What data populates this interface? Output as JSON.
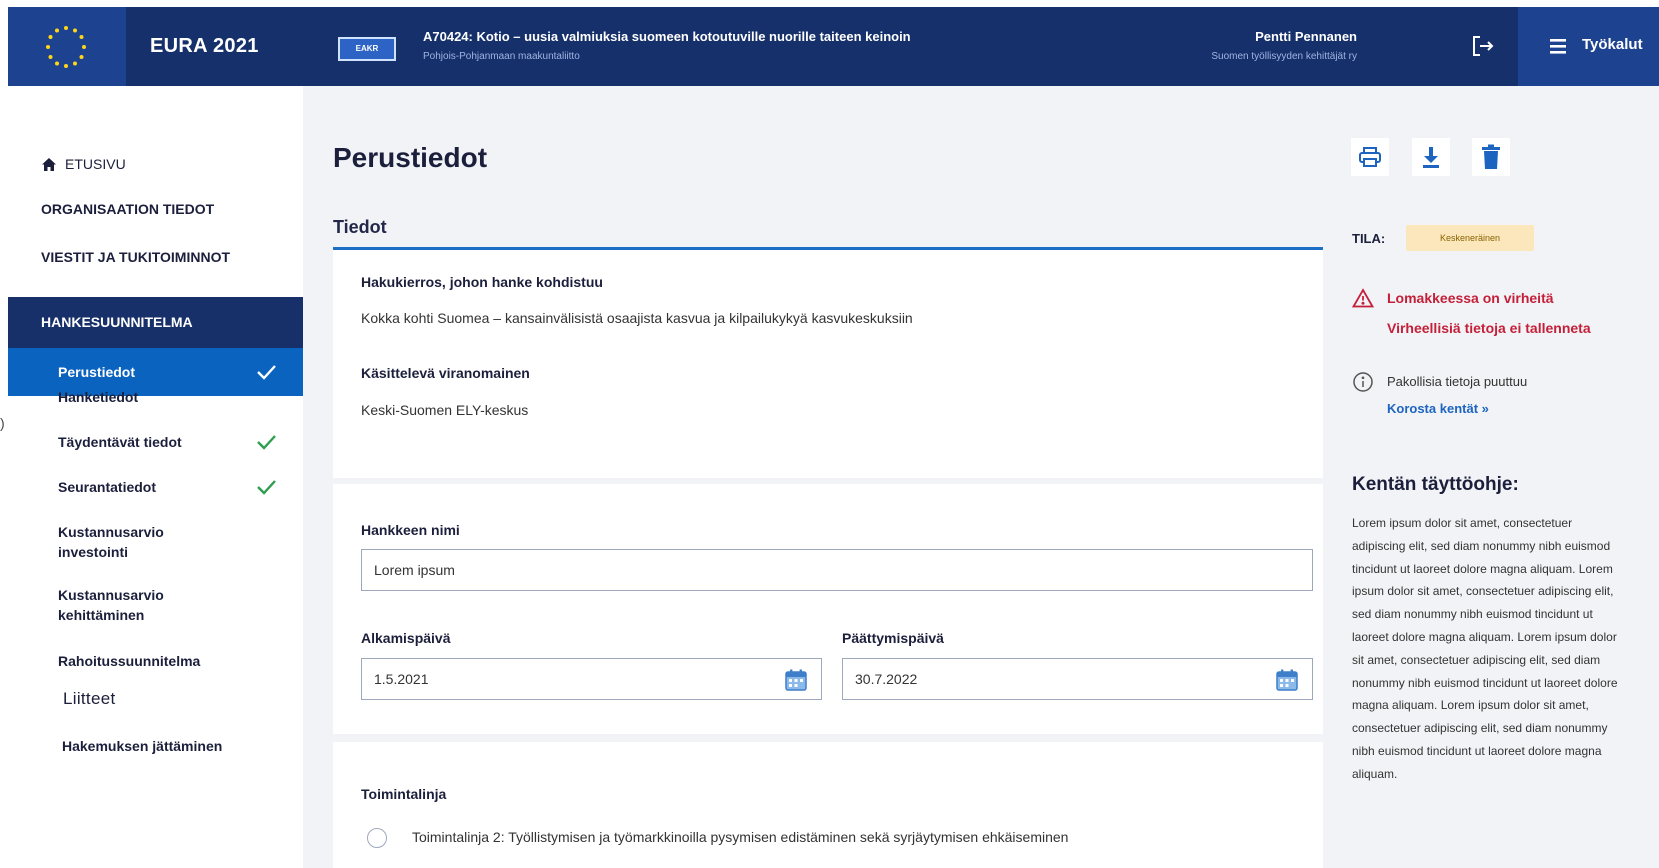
{
  "header": {
    "app_name": "EURA 2021",
    "fund_badge": "EAKR",
    "project_title": "A70424: Kotio – uusia valmiuksia suomeen kotoutuville nuorille taiteen keinoin",
    "project_org": "Pohjois-Pohjanmaan maakuntaliitto",
    "user_name": "Pentti Pennanen",
    "user_org": "Suomen työllisyyden kehittäjät ry",
    "tools_label": "Työkalut"
  },
  "sidebar": {
    "home_label": "ETUSIVU",
    "org_label": "ORGANISAATION TIEDOT",
    "messages_label": "VIESTIT JA TUKITOIMINNOT",
    "section_label": "HANKESUUNNITELMA",
    "items": [
      {
        "label": "Perustiedot",
        "checked": true,
        "active": true
      },
      {
        "label": "Hanketiedot",
        "checked": false
      },
      {
        "label": "Täydentävät tiedot",
        "checked": true
      },
      {
        "label": "Seurantatiedot",
        "checked": true
      },
      {
        "label_line1": "Kustannusarvio",
        "label_line2": "investointi",
        "checked": false
      },
      {
        "label_line1": "Kustannusarvio",
        "label_line2": "kehittäminen",
        "checked": false
      },
      {
        "label": "Rahoitussuunnitelma",
        "checked": false
      },
      {
        "label": "Liitteet",
        "checked": false
      },
      {
        "label": "Hakemuksen jättäminen",
        "checked": false
      }
    ],
    "collapse_glyph": ")"
  },
  "main": {
    "page_title": "Perustiedot",
    "tab_label": "Tiedot",
    "call_label": "Hakukierros, johon hanke kohdistuu",
    "call_value": "Kokka kohti Suomea – kansainvälisistä osaajista kasvua ja kilpailukykyä kasvukeskuksiin",
    "authority_label": "Käsittelevä viranomainen",
    "authority_value": "Keski-Suomen ELY-keskus",
    "project_name_label": "Hankkeen nimi",
    "project_name_value": "Lorem ipsum",
    "start_label": "Alkamispäivä",
    "start_value": "1.5.2021",
    "end_label": "Päättymispäivä",
    "end_value": "30.7.2022",
    "policy_label": "Toimintalinja",
    "policy_option_1": "Toimintalinja 2: Työllistymisen ja työmarkkinoilla pysymisen edistäminen sekä syrjäytymisen ehkäiseminen"
  },
  "right_panel": {
    "status_label": "TILA:",
    "status_value": "Keskeneräinen",
    "error_line1": "Lomakkeessa on virheitä",
    "error_line2": "Virheellisiä tietoja ei tallenneta",
    "info_text": "Pakollisia tietoja puuttuu",
    "info_link": "Korosta kentät »",
    "help_title": "Kentän täyttöohje:",
    "help_body": "Lorem ipsum dolor sit amet, consectetuer adipiscing elit, sed diam nonummy nibh euismod tincidunt ut laoreet dolore magna aliquam. Lorem ipsum dolor sit amet, consectetuer adipiscing elit, sed diam nonummy nibh euismod tincidunt ut laoreet dolore magna aliquam. Lorem ipsum dolor sit amet, consectetuer adipiscing elit, sed diam nonummy nibh euismod tincidunt ut laoreet dolore magna aliquam. Lorem ipsum dolor sit amet, consectetuer adipiscing elit, sed diam nonummy nibh euismod tincidunt ut laoreet dolore magna aliquam."
  },
  "icons": {
    "eu_flag": "eu-flag-icon",
    "logout": "logout-icon",
    "menu": "menu-icon",
    "home": "home-icon",
    "check": "check-icon",
    "print": "print-icon",
    "download": "download-icon",
    "delete": "trash-icon",
    "warning": "warning-icon",
    "info": "info-icon",
    "calendar": "calendar-icon"
  },
  "colors": {
    "header_bg": "#16306b",
    "accent_blue": "#0b63c0",
    "error_red": "#c4203a",
    "check_green": "#2e9e4f",
    "status_badge_bg": "#fbe7bb"
  }
}
